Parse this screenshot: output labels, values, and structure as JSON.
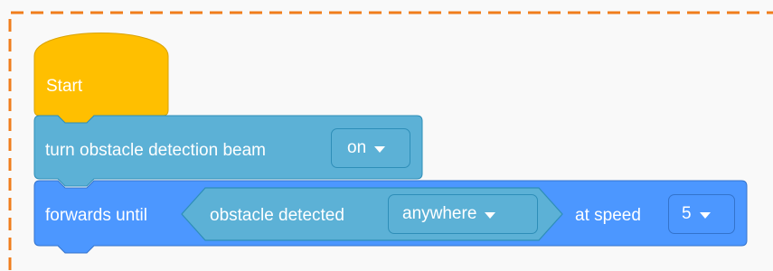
{
  "colors": {
    "canvas_bg": "#f9f9f9",
    "frame_dash": "#f07d1c",
    "start_block": "#ffbf00",
    "start_block_border": "#d9a200",
    "looks_block": "#5cb1d6",
    "looks_block_border": "#2e8eb8",
    "motion_block": "#4c97ff",
    "motion_block_border": "#3373cc",
    "sensing_reporter": "#5cb1d6",
    "sensing_reporter_border": "#2e8eb8",
    "text": "#ffffff"
  },
  "blocks": {
    "start": {
      "label": "Start"
    },
    "beam": {
      "label": "turn obstacle detection beam",
      "dropdown": {
        "value": "on",
        "icon": "caret-down-icon"
      }
    },
    "forwards": {
      "label": "forwards until",
      "condition": {
        "label": "obstacle detected",
        "dropdown": {
          "value": "anywhere",
          "icon": "caret-down-icon"
        }
      },
      "speed_label": "at speed",
      "speed_dropdown": {
        "value": "5",
        "icon": "caret-down-icon"
      }
    }
  }
}
